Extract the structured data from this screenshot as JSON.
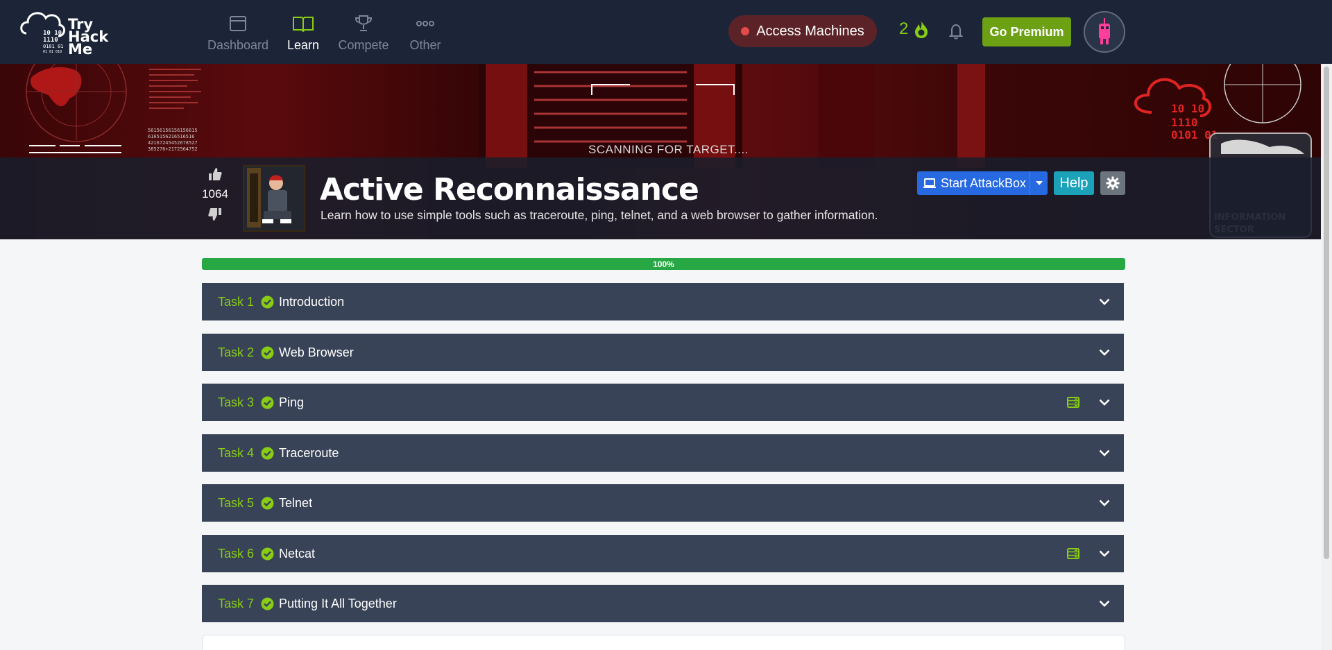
{
  "logo": {
    "text_line1": "Try",
    "text_line2": "Hack",
    "text_line3": "Me"
  },
  "nav": {
    "items": [
      {
        "label": "Dashboard",
        "icon": "dashboard-icon"
      },
      {
        "label": "Learn",
        "icon": "book-icon"
      },
      {
        "label": "Compete",
        "icon": "trophy-icon"
      },
      {
        "label": "Other",
        "icon": "dots-icon"
      }
    ],
    "active": "Learn",
    "access_machines_label": "Access Machines",
    "streak_count": "2",
    "premium_label": "Go Premium"
  },
  "hero": {
    "scanning_text": "SCANNING FOR TARGET....",
    "vote_count": "1064",
    "title": "Active Reconnaissance",
    "description": "Learn how to use simple tools such as traceroute, ping, telnet, and a web browser to gather information.",
    "attackbox_label": "Start AttackBox",
    "help_label": "Help"
  },
  "progress": {
    "value": 100,
    "label": "100%"
  },
  "tasks": [
    {
      "num": "Task 1",
      "name": "Introduction",
      "has_machine": false,
      "completed": true
    },
    {
      "num": "Task 2",
      "name": "Web Browser",
      "has_machine": false,
      "completed": true
    },
    {
      "num": "Task 3",
      "name": "Ping",
      "has_machine": true,
      "completed": true
    },
    {
      "num": "Task 4",
      "name": "Traceroute",
      "has_machine": false,
      "completed": true
    },
    {
      "num": "Task 5",
      "name": "Telnet",
      "has_machine": false,
      "completed": true
    },
    {
      "num": "Task 6",
      "name": "Netcat",
      "has_machine": true,
      "completed": true
    },
    {
      "num": "Task 7",
      "name": "Putting It All Together",
      "has_machine": false,
      "completed": true
    }
  ],
  "colors": {
    "navbar": "#1c2538",
    "accent_green": "#88cc14",
    "task_bg": "#394357",
    "progress_green": "#28a745",
    "attackbox_blue": "#2669e0",
    "help_teal": "#1ba2b8"
  }
}
